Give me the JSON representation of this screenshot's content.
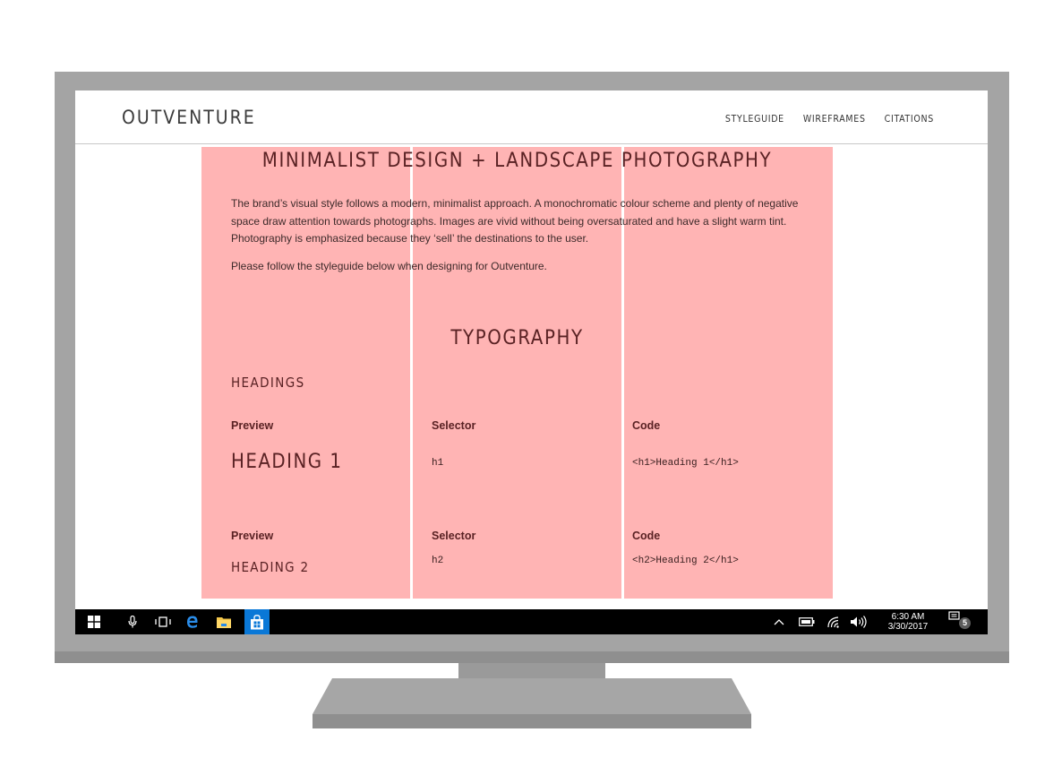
{
  "site": {
    "logo": "OUTVENTURE",
    "nav": [
      "STYLEGUIDE",
      "WIREFRAMES",
      "CITATIONS"
    ]
  },
  "page": {
    "title": "MINIMALIST DESIGN + LANDSCAPE PHOTOGRAPHY",
    "intro_lines": [
      "The brand’s visual style follows a modern, minimalist approach. A monochromatic colour scheme and plenty of negative",
      "space draw attention towards photographs. Images are vivid without being oversaturated and have a slight warm tint.",
      "Photography is emphasized because they ‘sell’ the destinations to the user."
    ],
    "intro2": "Please follow the styleguide below when designing for Outventure."
  },
  "typography": {
    "section_title": "TYPOGRAPHY",
    "subtitle": "HEADINGS",
    "rows": [
      {
        "preview_label": "Preview",
        "selector_label": "Selector",
        "code_label": "Code",
        "preview": "HEADING 1",
        "selector": "h1",
        "code": "<h1>Heading 1</h1>"
      },
      {
        "preview_label": "Preview",
        "selector_label": "Selector",
        "code_label": "Code",
        "preview": "HEADING 2",
        "selector": "h2",
        "code": "<h2>Heading 2</h1>"
      }
    ]
  },
  "taskbar": {
    "apps": [
      "start-icon",
      "microphone-icon",
      "task-view-icon",
      "edge-icon",
      "file-explorer-icon",
      "store-icon"
    ],
    "tray_icons": [
      "chevron-up-icon",
      "battery-icon",
      "wifi-icon",
      "volume-icon"
    ],
    "time": "6:30 AM",
    "date": "3/30/2017",
    "notification_count": "5"
  },
  "colors": {
    "overlay": "#ff5f5f",
    "heading": "#5a2224",
    "taskbar": "#000000",
    "store_accent": "#0a78d7"
  }
}
